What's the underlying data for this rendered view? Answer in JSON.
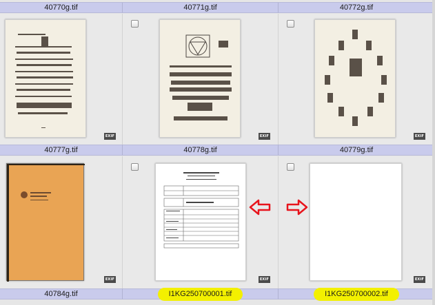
{
  "top_labels": [
    "40770g.tif",
    "40771g.tif",
    "40772g.tif"
  ],
  "row1": {
    "labels": [
      "40777g.tif",
      "40778g.tif",
      "40779g.tif"
    ]
  },
  "row2": {
    "labels": [
      "40784g.tif",
      "I1KG250700001.tif",
      "I1KG250700002.tif"
    ]
  },
  "exif_badge": "EXIF",
  "colors": {
    "label_bg": "#c9cbec",
    "highlight": "#f3f000",
    "arrow": "#e8141c",
    "cell_bg": "#e9e9e9",
    "orange_cover": "#e9a454"
  },
  "icons": {
    "arrow_left": "left-arrow-icon",
    "arrow_right": "right-arrow-icon"
  }
}
